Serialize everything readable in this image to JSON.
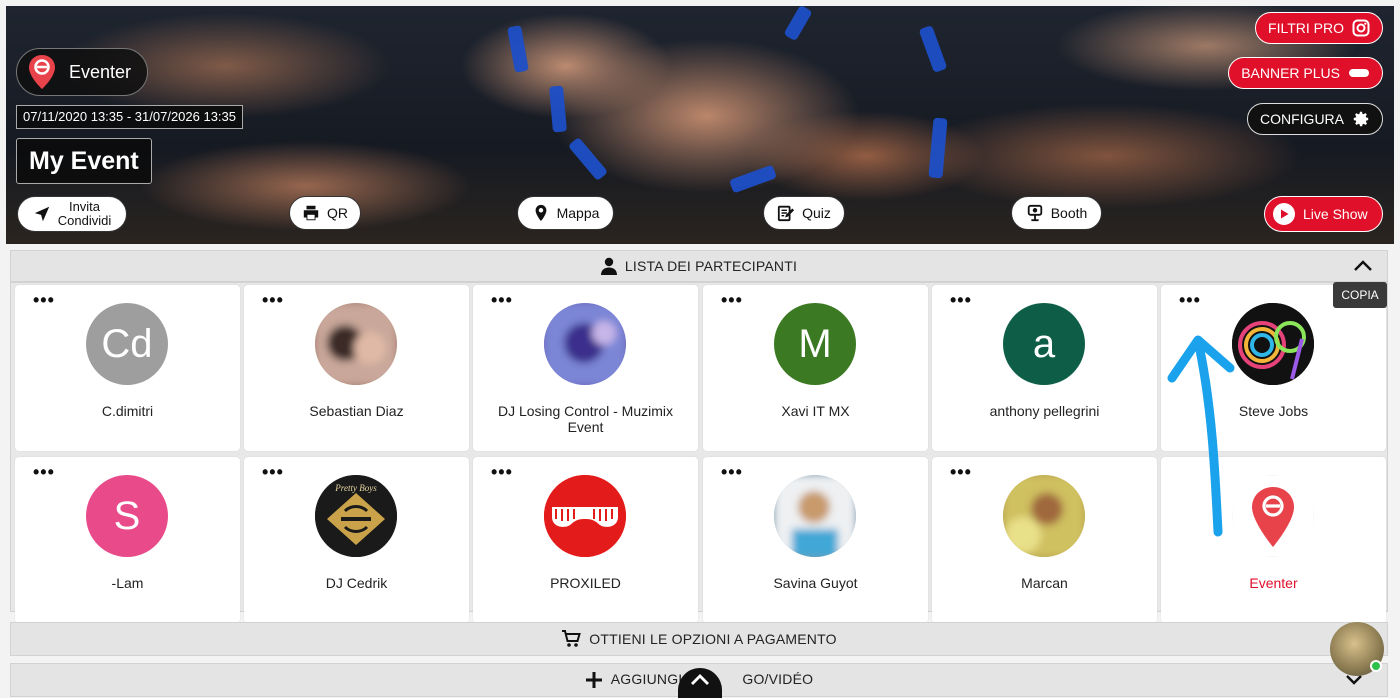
{
  "header": {
    "brand_name": "Eventer",
    "date_range": "07/11/2020 13:35 - 31/07/2026 13:35",
    "event_title": "My Event",
    "actions": {
      "invite": [
        "Invita",
        "Condividi"
      ],
      "qr": "QR",
      "map": "Mappa",
      "quiz": "Quiz",
      "booth": "Booth",
      "live_show": "Live Show"
    },
    "top_right": {
      "filters_pro": "FILTRI PRO",
      "banner_plus": "BANNER PLUS",
      "configure": "CONFIGURA"
    }
  },
  "participants": {
    "section_label": "LISTA DEI PARTECIPANTI",
    "tooltip": "COPIA",
    "more_label": "•••",
    "items": [
      {
        "name": "C.dimitri",
        "initials": "Cd",
        "color": "#9e9e9e"
      },
      {
        "name": "Sebastian Diaz",
        "initials": "",
        "color": "#a37a73"
      },
      {
        "name": "DJ Losing Control - Muzimix Event",
        "initials": "",
        "color": "#6b64b8"
      },
      {
        "name": "Xavi IT MX",
        "initials": "M",
        "color": "#3b7a22"
      },
      {
        "name": "anthony pellegrini",
        "initials": "a",
        "color": "#0e5e47"
      },
      {
        "name": "Steve Jobs",
        "initials": "",
        "color": "#111111"
      },
      {
        "name": "-Lam",
        "initials": "S",
        "color": "#e84a8a"
      },
      {
        "name": "DJ Cedrik",
        "initials": "",
        "color": "#1a1a1a"
      },
      {
        "name": "PROXILED",
        "initials": "",
        "color": "#e41b1b"
      },
      {
        "name": "Savina Guyot",
        "initials": "",
        "color": "#7f9ab0"
      },
      {
        "name": "Marcan",
        "initials": "",
        "color": "#b5a24c"
      },
      {
        "name": "Eventer",
        "initials": "",
        "color": "#ffffff"
      }
    ]
  },
  "paid_options": {
    "label": "OTTIENI LE OPZIONI A PAGAMENTO"
  },
  "add_media": {
    "label": "AGGIUNGI LOGO/VIDÉO",
    "label_visible_left": "AGGIUNGI",
    "label_visible_right": "GO/VIDÉO"
  },
  "colors": {
    "accent_red": "#e0102a",
    "header_bg": "#e4e4e4"
  }
}
